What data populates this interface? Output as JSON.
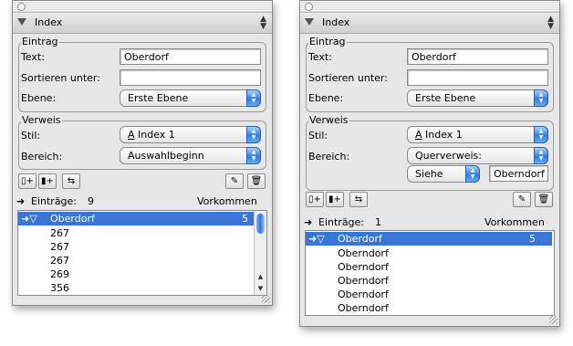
{
  "panels": [
    {
      "title": "Index",
      "entry_group": "Eintrag",
      "text_label": "Text:",
      "text_value": "Oberdorf",
      "sort_label": "Sortieren unter:",
      "sort_value": "",
      "level_label": "Ebene:",
      "level_value": "Erste Ebene",
      "ref_group": "Verweis",
      "style_label": "Stil:",
      "style_value": "Index 1",
      "range_label": "Bereich:",
      "range_value": "Auswahlbeginn",
      "entries_label": "Einträge:",
      "entries_count": "9",
      "occurrences_label": "Vorkommen",
      "selected_entry": "Oberdorf",
      "selected_count": "5",
      "rows": [
        "267",
        "267",
        "267",
        "269",
        "356"
      ]
    },
    {
      "title": "Index",
      "entry_group": "Eintrag",
      "text_label": "Text:",
      "text_value": "Oberdorf",
      "sort_label": "Sortieren unter:",
      "sort_value": "",
      "level_label": "Ebene:",
      "level_value": "Erste Ebene",
      "ref_group": "Verweis",
      "style_label": "Stil:",
      "style_value": "Index 1",
      "range_label": "Bereich:",
      "range_value": "Querverweis:",
      "see_value": "Siehe",
      "see_field_value": "Oberndorf",
      "entries_label": "Einträge:",
      "entries_count": "1",
      "occurrences_label": "Vorkommen",
      "selected_entry": "Oberdorf",
      "selected_count": "5",
      "rows": [
        "Oberndorf",
        "Oberndorf",
        "Oberndorf",
        "Oberndorf",
        "Oberndorf"
      ]
    }
  ],
  "icons": {
    "triangle": "▼",
    "popup_arrows": "▲▼",
    "entries_arrow": "➜",
    "expand_arrow": "➜▽",
    "pencil": "✎",
    "trash": "🗑"
  }
}
